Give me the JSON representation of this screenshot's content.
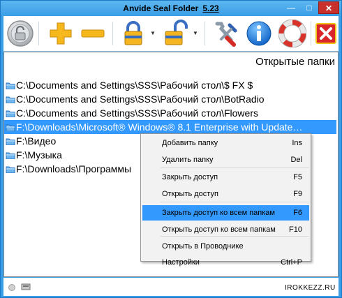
{
  "window": {
    "title": "Anvide Seal Folder",
    "version": "5.23",
    "min_glyph": "—",
    "max_glyph": "□",
    "close_glyph": "✕"
  },
  "toolbar": {
    "items": [
      {
        "name": "lock-big-icon"
      },
      {
        "name": "add-icon"
      },
      {
        "name": "remove-icon"
      },
      {
        "name": "close-access-icon"
      },
      {
        "name": "open-access-icon"
      },
      {
        "name": "settings-icon"
      },
      {
        "name": "info-icon"
      },
      {
        "name": "help-icon"
      },
      {
        "name": "exit-icon"
      }
    ]
  },
  "main": {
    "header": "Открытые папки",
    "folders": [
      "C:\\Documents and Settings\\SSS\\Рабочий стол\\$ FX $",
      "C:\\Documents and Settings\\SSS\\Рабочий стол\\BotRadio",
      "C:\\Documents and Settings\\SSS\\Рабочий стол\\Flowers",
      "F:\\Downloads\\Microsoft® Windows® 8.1 Enterprise with Update…",
      "F:\\Видео",
      "F:\\Музыка",
      "F:\\Downloads\\Программы"
    ]
  },
  "context_menu": {
    "items": [
      {
        "label": "Добавить папку",
        "shortcut": "Ins"
      },
      {
        "label": "Удалить папку",
        "shortcut": "Del"
      },
      {
        "label": "Закрыть доступ",
        "shortcut": "F5"
      },
      {
        "label": "Открыть доступ",
        "shortcut": "F9"
      },
      {
        "label": "Закрыть доступ ко всем папкам",
        "shortcut": "F6"
      },
      {
        "label": "Открыть доступ ко всем папкам",
        "shortcut": "F10"
      },
      {
        "label": "Открыть в Проводнике",
        "shortcut": ""
      },
      {
        "label": "Настройки",
        "shortcut": "Ctrl+P"
      }
    ]
  },
  "watermark": "IROKKEZZ.RU"
}
